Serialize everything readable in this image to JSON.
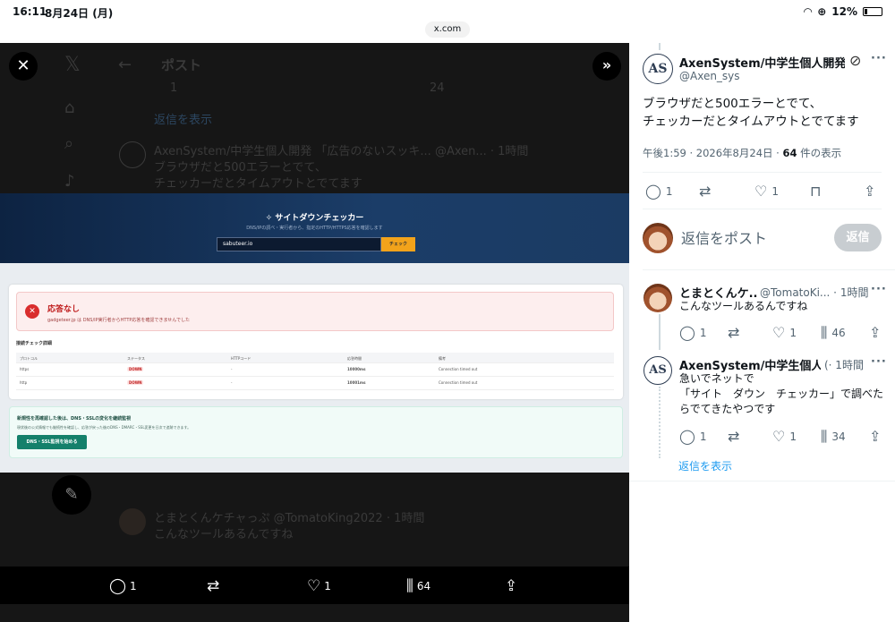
{
  "status_bar": {
    "time": "16:11",
    "date": "8月24日 (月)",
    "battery": "12%",
    "url": "x.com"
  },
  "background_feed": {
    "header_title": "ポスト",
    "row_counts": [
      "1",
      "24"
    ],
    "show_more": "返信を表示",
    "post_author": "AxenSystem/中学生個人開発 「広告のないスッキ... @Axen... · 1時間",
    "post_line1": "ブラウザだと500エラーとでて、",
    "post_line2": "チェッカーだとタイムアウトとでてます",
    "reply_author": "とまとくんケチャっぷ @TomatoKing2022 · 1時間",
    "reply_text": "こんなツールあるんですね"
  },
  "media": {
    "title": "✧ サイトダウンチェッカー",
    "subtitle": "DNS/IPの調べ・実行者から、指定のHTTP/HTTPS応答を確認します",
    "input_value": "sabuteer.io",
    "check_button": "チェック",
    "error_title": "応答なし",
    "error_detail": "gadgeteer.jp は DNS/IP実行者からHTTP応答を確認できませんでした",
    "detail_heading": "接続チェック詳細",
    "table_headers": [
      "プロトコル",
      "ステータス",
      "HTTPコード",
      "応答時間",
      "備考"
    ],
    "table_rows": [
      [
        "https",
        "DOWN",
        "-",
        "10000ms",
        "Connection timed out"
      ],
      [
        "http",
        "DOWN",
        "-",
        "10001ms",
        "Connection timed out"
      ]
    ],
    "tip_title": "新規性を再確認した後は、DNS・SSLの変化を継続監視",
    "tip_desc": "現状後の公式情報でも継続性を確認し、応答が戻った後のDNS・DMARC・SSL変更を日次で追跡できます。",
    "tip_button": "DNS・SSL監視を始める"
  },
  "media_actions": {
    "replies": "1",
    "likes": "1",
    "views": "64"
  },
  "main_post": {
    "avatar_text": "AS",
    "author": "AxenSystem/中学生個人開発...",
    "handle": "@Axen_sys",
    "text": "ブラウザだと500エラーとでて、\nチェッカーだとタイムアウトとでてます",
    "time": "午後1:59 · 2026年8月24日 · ",
    "views_count": "64",
    "views_label": " 件の表示",
    "replies": "1",
    "likes": "1"
  },
  "reply_box": {
    "placeholder": "返信をポスト",
    "button": "返信"
  },
  "replies": [
    {
      "author": "とまとくんケ...",
      "handle": "@TomatoKi... · 1時間",
      "text": "こんなツールあるんですね",
      "replies": "1",
      "likes": "1",
      "views": "46"
    },
    {
      "avatar_text": "AS",
      "author": "AxenSystem/中学生個人...",
      "handle": "(· 1時間",
      "text": "急いでネットで\n「サイト　ダウン　チェッカー」で調べたらでてきたやつです",
      "replies": "1",
      "likes": "1",
      "views": "34"
    }
  ],
  "show_replies": "返信を表示",
  "colors": {
    "accent": "#1d9bf0",
    "text_secondary": "#536471",
    "reply_button_disabled": "#c8cdd1"
  }
}
